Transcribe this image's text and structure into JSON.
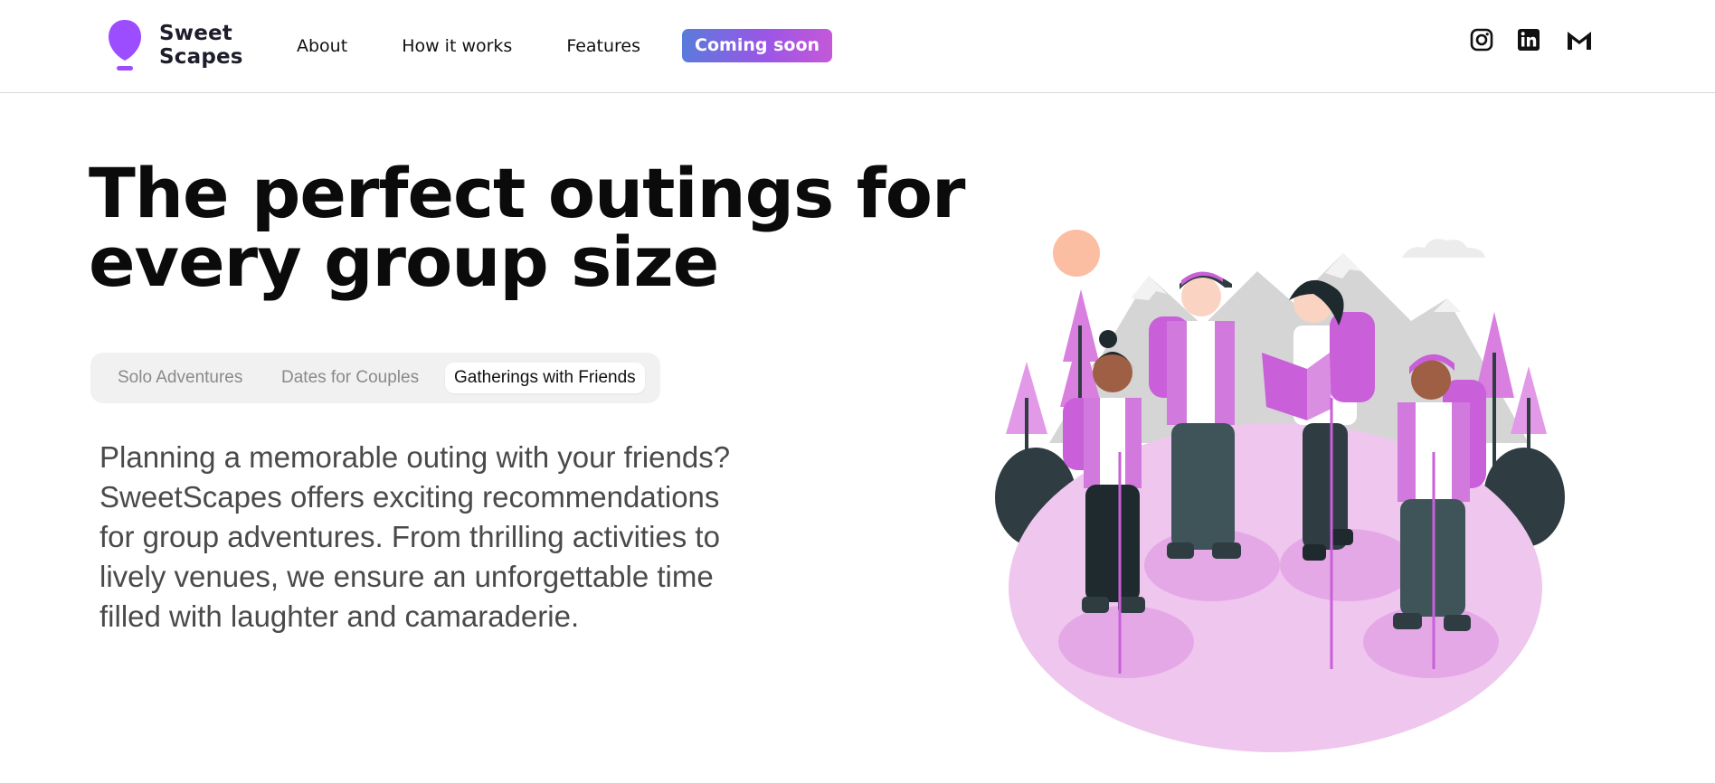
{
  "brand": {
    "name_line1": "Sweet",
    "name_line2": "Scapes",
    "logo_color": "#9b4dff"
  },
  "nav": {
    "links": [
      "About",
      "How it works",
      "Features"
    ],
    "cta_label": "Coming soon"
  },
  "social": {
    "icons": [
      "instagram-icon",
      "linkedin-icon",
      "gmail-icon"
    ]
  },
  "hero": {
    "title": "The perfect outings for every group size",
    "tabs": [
      {
        "label": "Solo Adventures",
        "active": false
      },
      {
        "label": "Dates for Couples",
        "active": false
      },
      {
        "label": "Gatherings with Friends",
        "active": true
      }
    ],
    "description": "Planning a memorable outing with your friends? SweetScapes offers exciting recommendations for group adventures. From thrilling activities to lively venues, we ensure an unforgettable time filled with laughter and camaraderie."
  },
  "illustration": {
    "subject": "group-of-hikers-illustration",
    "accent_color": "#c95fd9",
    "ground_color": "#efc6ee",
    "sun_color": "#fcbea2"
  }
}
